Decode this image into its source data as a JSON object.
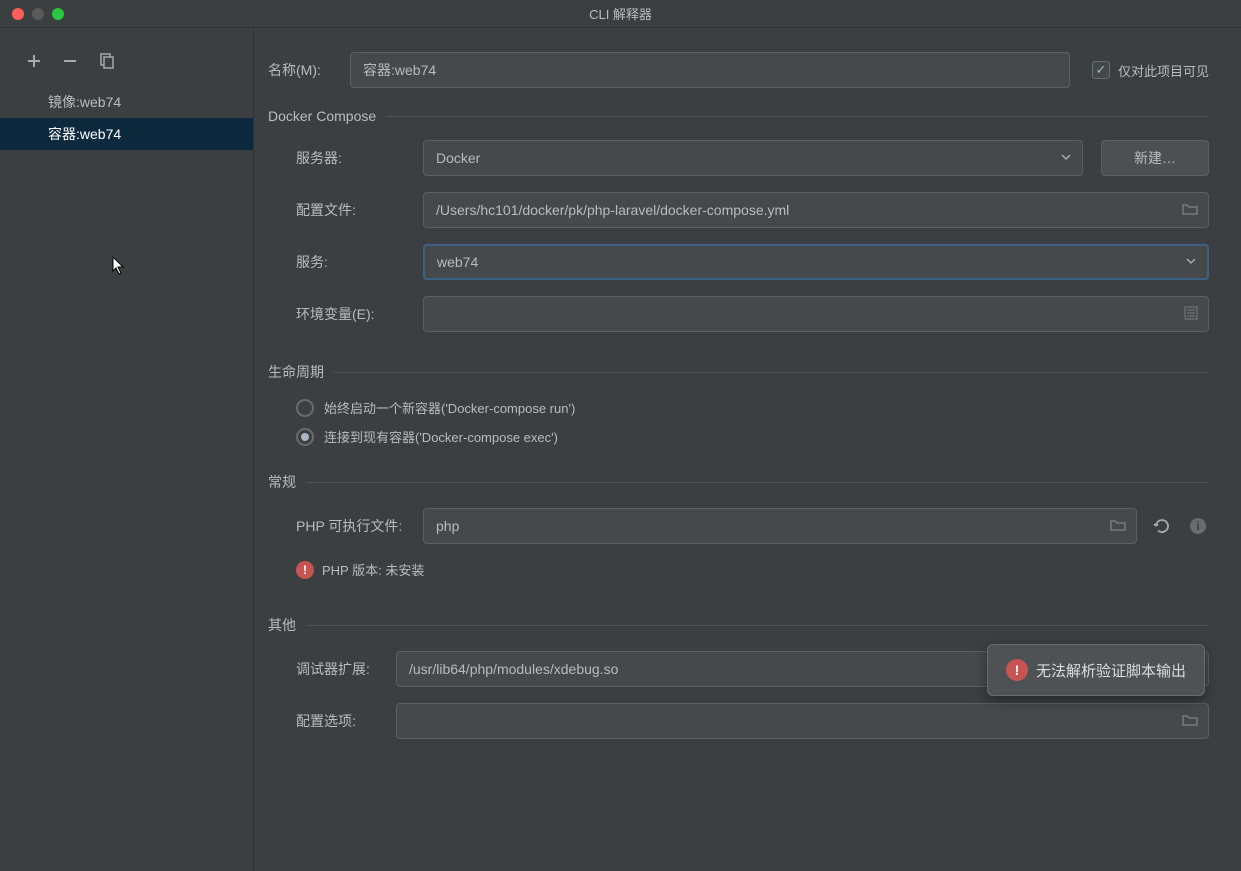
{
  "title": "CLI 解释器",
  "sidebar": {
    "items": [
      {
        "label": "镜像:web74"
      },
      {
        "label": "容器:web74"
      }
    ]
  },
  "form": {
    "name_label": "名称(M):",
    "name_value": "容器:web74",
    "visible_only_label": "仅对此项目可见"
  },
  "docker": {
    "section": "Docker Compose",
    "server_label": "服务器:",
    "server_value": "Docker",
    "new_btn": "新建…",
    "config_label": "配置文件:",
    "config_value": "/Users/hc101/docker/pk/php-laravel/docker-compose.yml",
    "service_label": "服务:",
    "service_value": "web74",
    "env_label": "环境变量(E):",
    "env_value": ""
  },
  "lifecycle": {
    "section": "生命周期",
    "opt_run": "始终启动一个新容器('Docker-compose run')",
    "opt_exec": "连接到现有容器('Docker-compose exec')"
  },
  "general": {
    "section": "常规",
    "php_exe_label": "PHP 可执行文件:",
    "php_exe_value": "php",
    "php_version_label": "PHP 版本: 未安装"
  },
  "other": {
    "section": "其他",
    "debugger_label": "调试器扩展:",
    "debugger_value": "/usr/lib64/php/modules/xdebug.so",
    "config_opt_label": "配置选项:",
    "config_opt_value": ""
  },
  "tooltip": {
    "text": "无法解析验证脚本输出"
  }
}
